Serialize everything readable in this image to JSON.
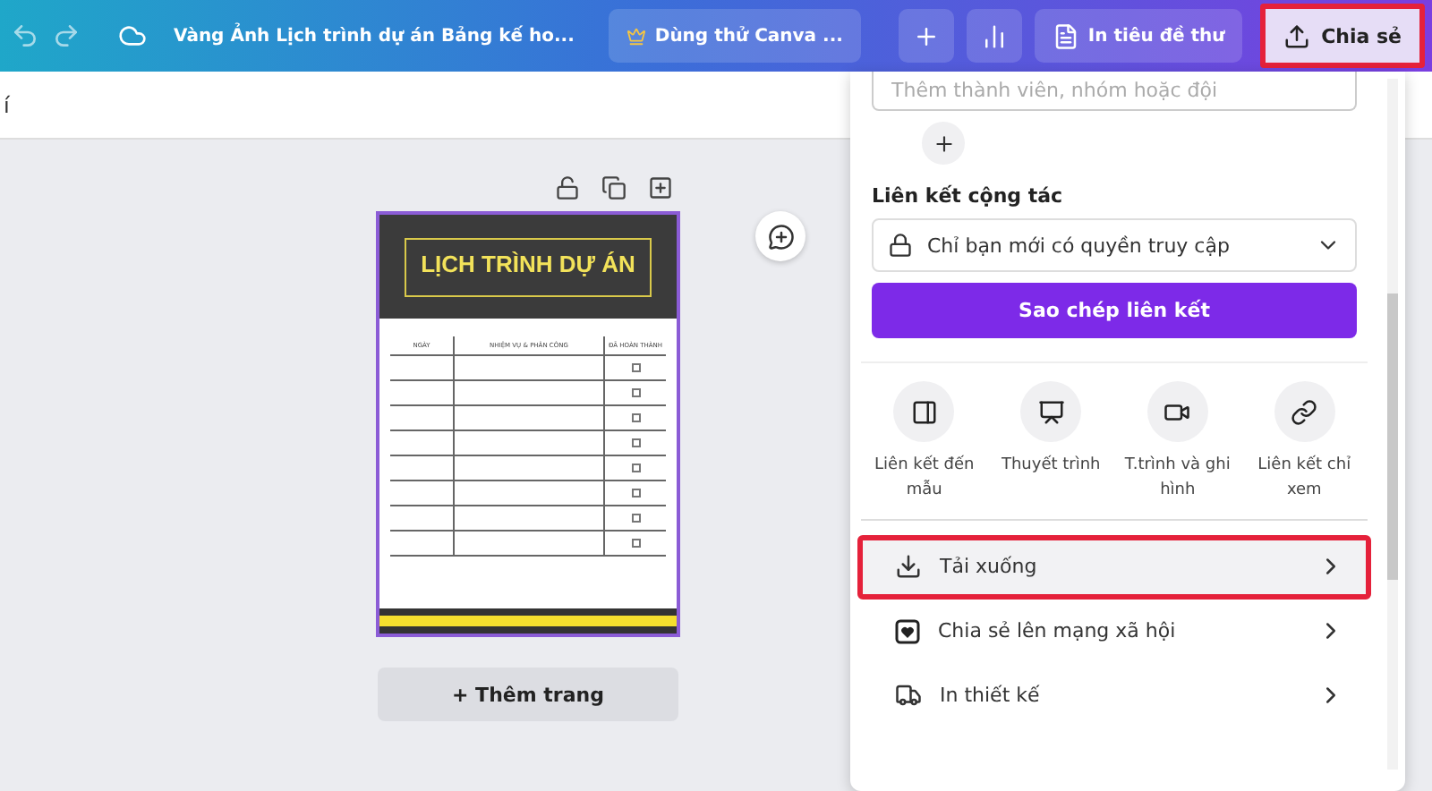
{
  "toolbar": {
    "doc_title": "Vàng Ảnh Lịch trình dự án Bảng kế ho...",
    "trial_button": "Dùng thử Canva ...",
    "print_button": "In tiêu đề thư",
    "share_button": {
      "label": "Chia sẻ",
      "highlighted": true
    }
  },
  "subbar_text": "í",
  "document": {
    "title": "LỊCH TRÌNH DỰ ÁN",
    "columns": [
      "NGÀY",
      "NHIỆM VỤ & PHÂN CÔNG",
      "ĐÃ HOÀN THÀNH"
    ],
    "rows": [
      {
        "checked": false
      },
      {
        "checked": false
      },
      {
        "checked": false
      },
      {
        "checked": false
      },
      {
        "checked": false
      },
      {
        "checked": false
      },
      {
        "checked": false
      },
      {
        "checked": false
      }
    ]
  },
  "add_page_button": "+ Thêm trang",
  "share_panel": {
    "member_placeholder": "Thêm thành viên, nhóm hoặc đội",
    "section_title": "Liên kết cộng tác",
    "access_select": "Chỉ bạn mới có quyền truy cập",
    "copy_button": "Sao chép liên kết",
    "options": [
      {
        "kind": "template",
        "label": "Liên kết đến mẫu"
      },
      {
        "kind": "present",
        "label": "Thuyết trình"
      },
      {
        "kind": "record",
        "label": "T.trình và ghi hình"
      },
      {
        "kind": "view",
        "label": "Liên kết chỉ xem"
      }
    ],
    "menu": [
      {
        "kind": "download",
        "label": "Tải xuống",
        "highlighted": true
      },
      {
        "kind": "social",
        "label": "Chia sẻ lên mạng xã hội",
        "highlighted": false
      },
      {
        "kind": "print",
        "label": "In thiết kế",
        "highlighted": false
      }
    ]
  }
}
